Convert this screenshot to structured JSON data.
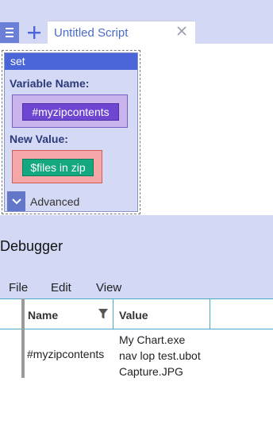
{
  "tabs": {
    "active_label": "Untitled Script"
  },
  "block": {
    "title": "set",
    "variable_name_label": "Variable Name:",
    "variable_value": "#myzipcontents",
    "new_value_label": "New Value:",
    "new_value": "$files in zip",
    "advanced_label": "Advanced"
  },
  "debugger": {
    "title": "Debugger",
    "menu": [
      "File",
      "Edit",
      "View"
    ],
    "columns": [
      "Name",
      "Value"
    ],
    "rows": [
      {
        "name": "#myzipcontents",
        "value_lines": [
          "My Chart.exe",
          "nav lop test.ubot",
          "Capture.JPG"
        ]
      }
    ]
  },
  "colors": {
    "chrome_bg": "#d3d8f5",
    "accent_blue": "#4a66d8",
    "variable_chip": "#6e46d1",
    "value_chip": "#13a87f"
  },
  "icons": [
    "hamburger-menu-icon",
    "plus-icon",
    "close-icon",
    "chevron-down-icon",
    "filter-icon"
  ]
}
